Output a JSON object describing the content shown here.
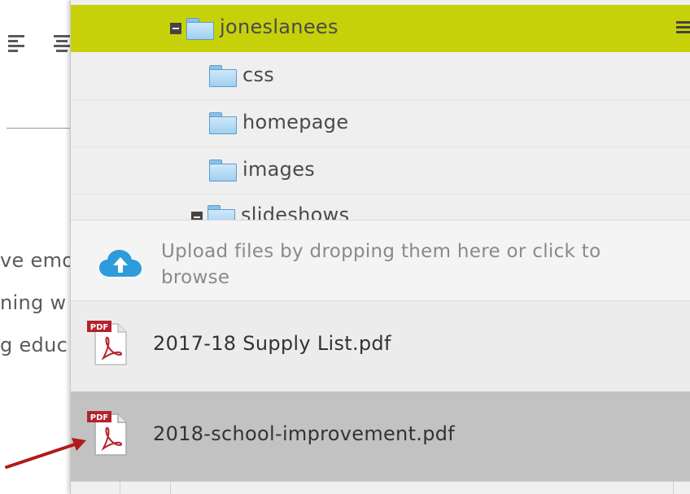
{
  "background_editor": {
    "text_lines": [
      "ve emo",
      "ning w",
      "g educ"
    ]
  },
  "file_browser": {
    "tree": {
      "selected_folder": "joneslanees",
      "subfolders": [
        "css",
        "homepage",
        "images"
      ],
      "partial_folder": "slideshows"
    },
    "upload": {
      "prompt": "Upload files by dropping them here or click to browse"
    },
    "files": [
      {
        "name": "2017-18 Supply List.pdf",
        "icon": "pdf-icon"
      },
      {
        "name": "2018-school-improvement.pdf",
        "icon": "pdf-icon",
        "highlighted": true
      }
    ]
  },
  "colors": {
    "selected_row": "#c6d10a",
    "highlighted_file": "#c2c2c2",
    "cloud_icon": "#2d9cdb",
    "annotation_arrow": "#b01c1c",
    "pdf_red": "#b3232b"
  },
  "icons": [
    "align-left-icon",
    "align-center-icon",
    "folder-icon",
    "collapse-icon",
    "menu-icon",
    "cloud-upload-icon",
    "pdf-icon",
    "arrow-annotation"
  ]
}
